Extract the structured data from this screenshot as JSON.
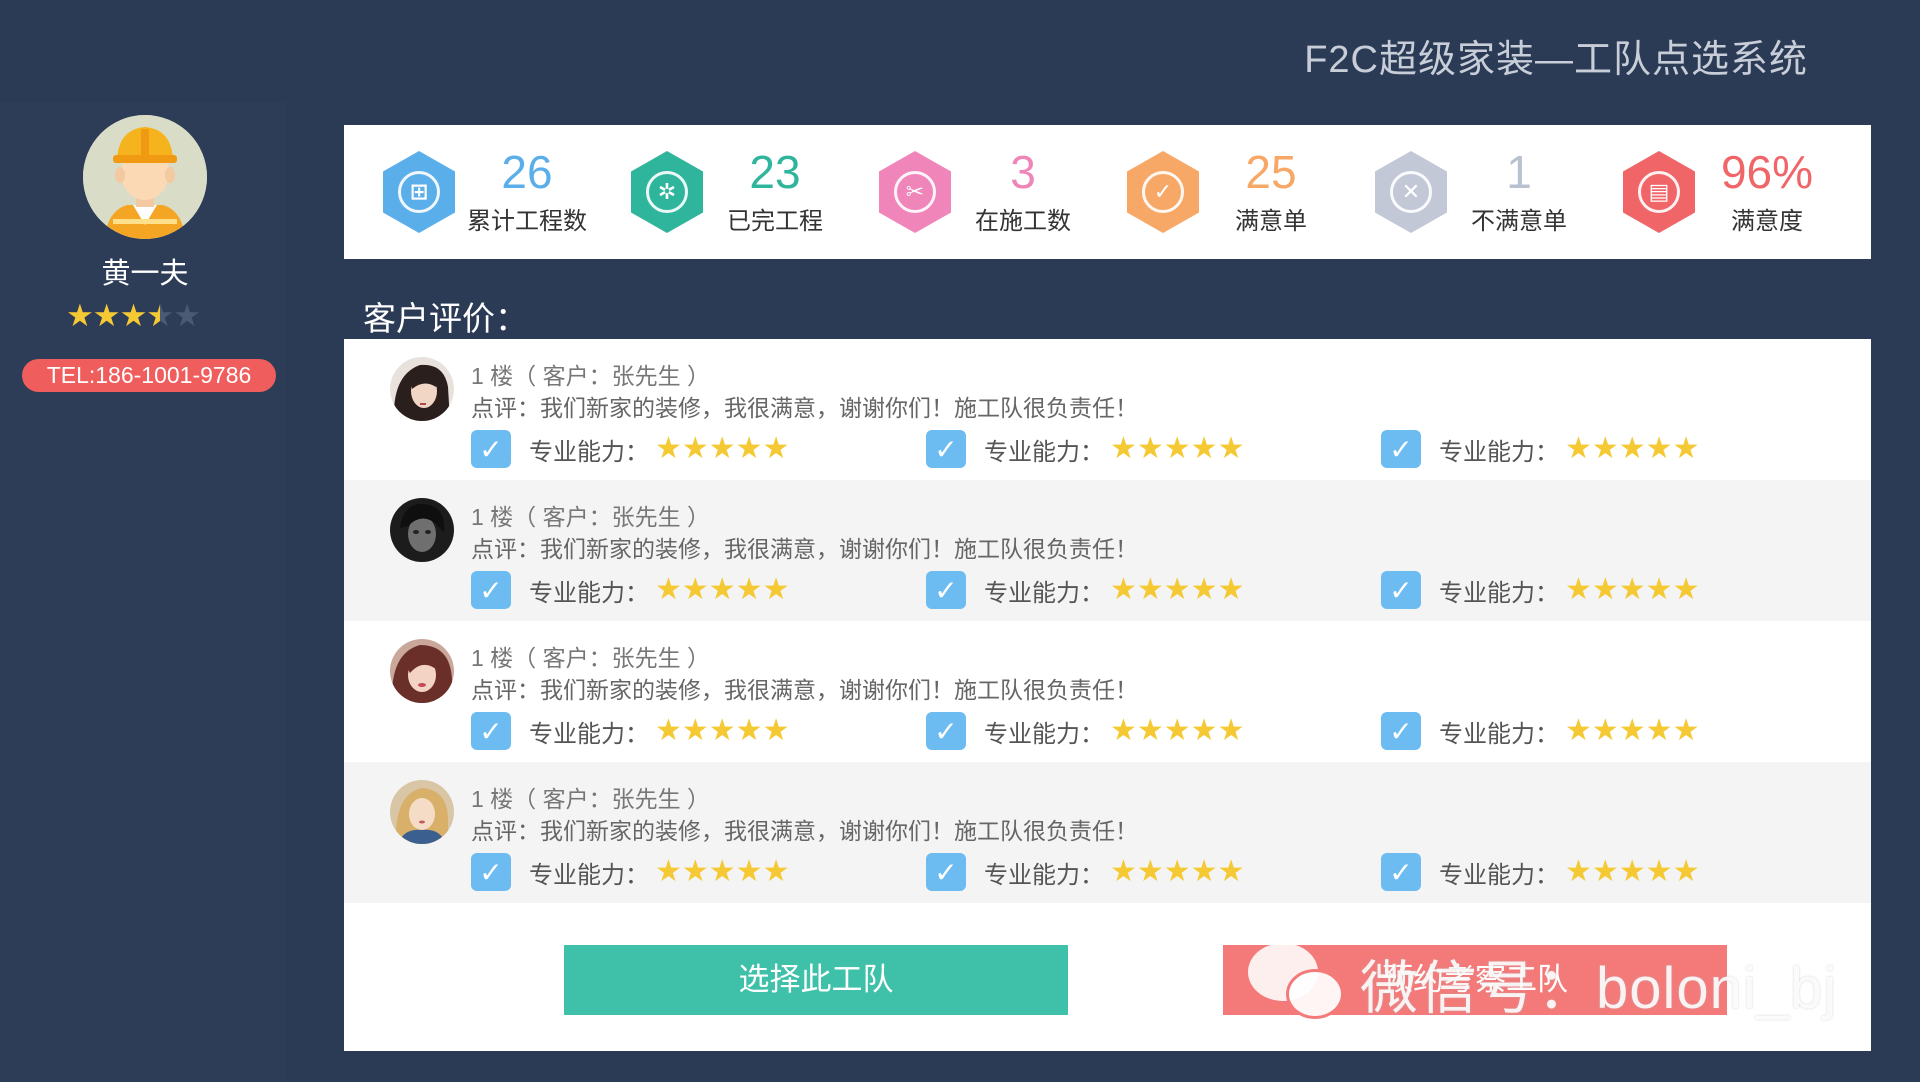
{
  "app": {
    "title": "F2C超级家装—工队点选系统"
  },
  "worker": {
    "name": "黄一夫",
    "rating": 3.5,
    "rating_max": 5,
    "tel": "TEL:186-1001-9786"
  },
  "stats": [
    {
      "value": "26",
      "label": "累计工程数",
      "color": "#5aaee9",
      "icon": "grid-icon"
    },
    {
      "value": "23",
      "label": "已完工程",
      "color": "#2fb59c",
      "icon": "gear-icon"
    },
    {
      "value": "3",
      "label": "在施工数",
      "color": "#ef85b9",
      "icon": "tools-icon"
    },
    {
      "value": "25",
      "label": "满意单",
      "color": "#f7a866",
      "icon": "check-icon"
    },
    {
      "value": "1",
      "label": "不满意单",
      "color": "#c2c8d6",
      "icon": "x-icon"
    },
    {
      "value": "96%",
      "label": "满意度",
      "color": "#f06567",
      "icon": "document-icon"
    }
  ],
  "reviews_heading": "客户评价：",
  "reviews": [
    {
      "floor": "1 楼（ 客户：张先生 ）",
      "comment": "点评：我们新家的装修，我很满意，谢谢你们！施工队很负责任！",
      "ratings": [
        {
          "label": "专业能力：",
          "stars": "★★★★★"
        },
        {
          "label": "专业能力：",
          "stars": "★★★★★"
        },
        {
          "label": "专业能力：",
          "stars": "★★★★★"
        }
      ]
    },
    {
      "floor": "1 楼（ 客户：张先生 ）",
      "comment": "点评：我们新家的装修，我很满意，谢谢你们！施工队很负责任！",
      "ratings": [
        {
          "label": "专业能力：",
          "stars": "★★★★★"
        },
        {
          "label": "专业能力：",
          "stars": "★★★★★"
        },
        {
          "label": "专业能力：",
          "stars": "★★★★★"
        }
      ]
    },
    {
      "floor": "1 楼（ 客户：张先生 ）",
      "comment": "点评：我们新家的装修，我很满意，谢谢你们！施工队很负责任！",
      "ratings": [
        {
          "label": "专业能力：",
          "stars": "★★★★★"
        },
        {
          "label": "专业能力：",
          "stars": "★★★★★"
        },
        {
          "label": "专业能力：",
          "stars": "★★★★★"
        }
      ]
    },
    {
      "floor": "1 楼（ 客户：张先生 ）",
      "comment": "点评：我们新家的装修，我很满意，谢谢你们！施工队很负责任！",
      "ratings": [
        {
          "label": "专业能力：",
          "stars": "★★★★★"
        },
        {
          "label": "专业能力：",
          "stars": "★★★★★"
        },
        {
          "label": "专业能力：",
          "stars": "★★★★★"
        }
      ]
    }
  ],
  "actions": {
    "select_label": "选择此工队",
    "second_label": "预约考察工队"
  },
  "watermark": {
    "text": "微信号：boloni_bj"
  }
}
